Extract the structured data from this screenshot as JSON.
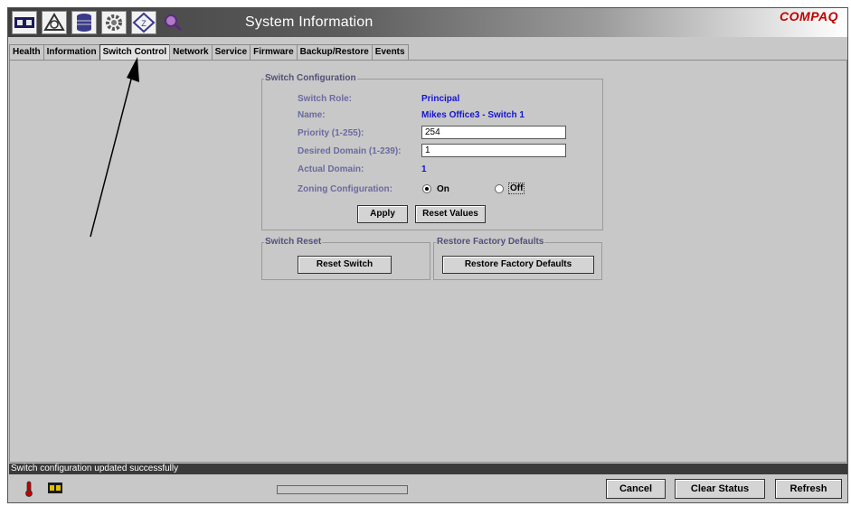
{
  "window": {
    "title": "System Information",
    "brand": "COMPAQ",
    "toolbar_icons": [
      "switch-icon",
      "fabric-icon",
      "database-icon",
      "gear-icon",
      "zoning-icon",
      "search-icon"
    ]
  },
  "tabs": [
    {
      "label": "Health",
      "active": false
    },
    {
      "label": "Information",
      "active": false
    },
    {
      "label": "Switch Control",
      "active": true
    },
    {
      "label": "Network",
      "active": false
    },
    {
      "label": "Service",
      "active": false
    },
    {
      "label": "Firmware",
      "active": false
    },
    {
      "label": "Backup/Restore",
      "active": false
    },
    {
      "label": "Events",
      "active": false
    }
  ],
  "switch_config": {
    "legend": "Switch Configuration",
    "role_label": "Switch Role:",
    "role_value": "Principal",
    "name_label": "Name:",
    "name_value": "Mikes Office3 - Switch 1",
    "priority_label": "Priority (1-255):",
    "priority_value": "254",
    "desired_domain_label": "Desired Domain (1-239):",
    "desired_domain_value": "1",
    "actual_domain_label": "Actual Domain:",
    "actual_domain_value": "1",
    "zoning_label": "Zoning Configuration:",
    "zoning_on_label": "On",
    "zoning_off_label": "Off",
    "zoning_selected": "On",
    "apply_label": "Apply",
    "reset_values_label": "Reset Values"
  },
  "switch_reset": {
    "legend": "Switch Reset",
    "button_label": "Reset Switch"
  },
  "factory_defaults": {
    "legend": "Restore Factory Defaults",
    "button_label": "Restore Factory Defaults"
  },
  "status": {
    "message": "Switch configuration updated successfully",
    "progress": 0
  },
  "bottom": {
    "cancel_label": "Cancel",
    "clear_status_label": "Clear Status",
    "refresh_label": "Refresh",
    "status_icons": [
      "temperature-icon",
      "switch-status-icon"
    ]
  },
  "colors": {
    "label": "#6a6aa0",
    "value": "#1414d2",
    "brand": "#c00000",
    "status_bar": "#3a3a3a"
  }
}
